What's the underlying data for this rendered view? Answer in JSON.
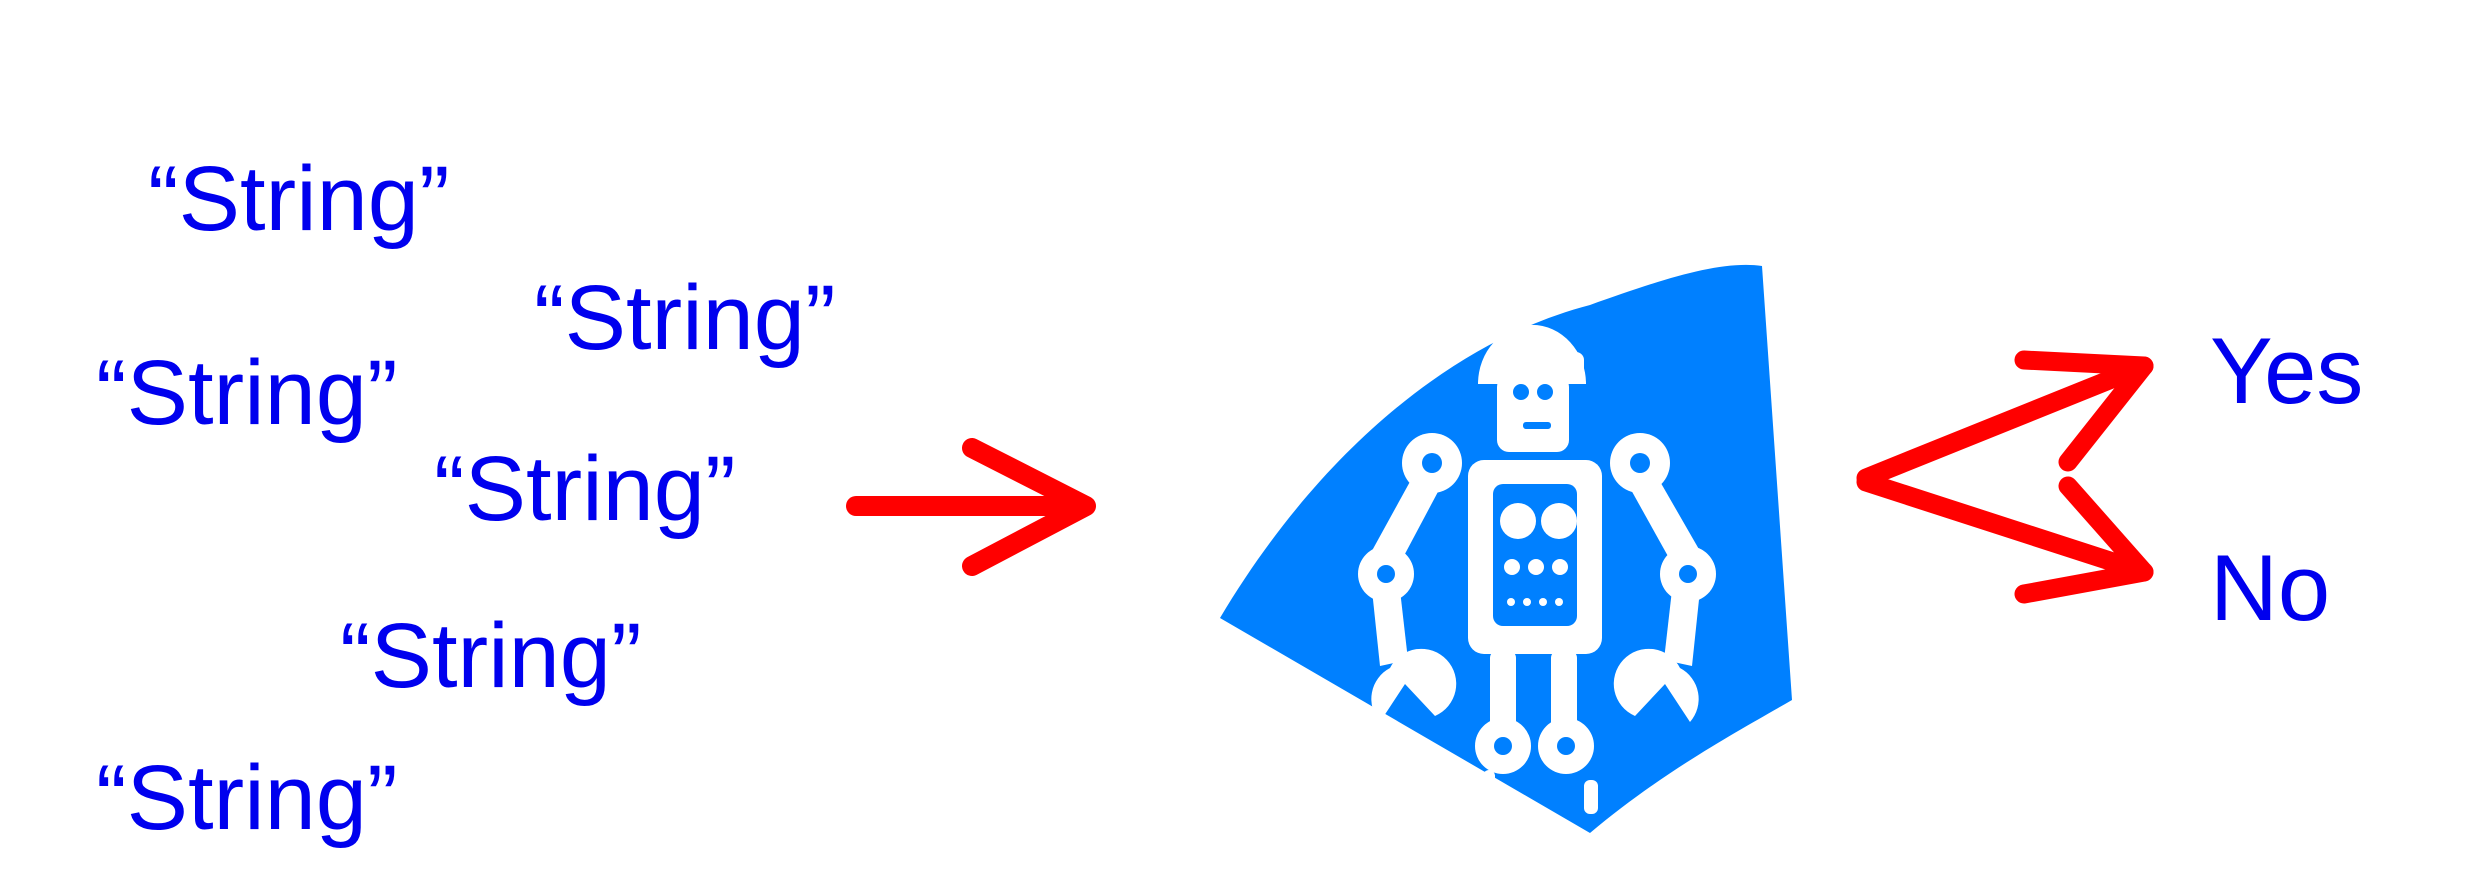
{
  "input_strings": [
    "“String”",
    "“String”",
    "“String”",
    "“String”",
    "“String”",
    "“String”"
  ],
  "outputs": {
    "yes": "Yes",
    "no": "No"
  },
  "colors": {
    "text": "#0000ee",
    "arrow": "#ff0000",
    "robot_background": "#0080ff",
    "robot": "#ffffff"
  },
  "icons": {
    "classifier": "robot-icon"
  }
}
